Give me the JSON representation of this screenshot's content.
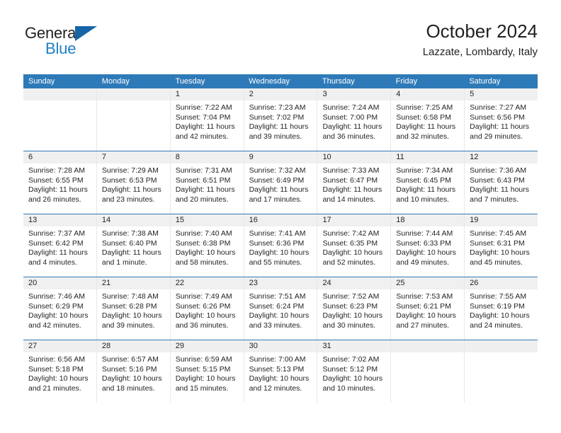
{
  "brand": {
    "name_top": "General",
    "name_bottom": "Blue",
    "logo_icon": "blue-triangle-icon",
    "colors": {
      "dark": "#231f20",
      "blue": "#1f7fc4",
      "triangle": "#1565a8"
    }
  },
  "header": {
    "title": "October 2024",
    "subtitle": "Lazzate, Lombardy, Italy"
  },
  "theme": {
    "header_blue": "#2e7ab8",
    "daynum_band": "#f0f0f0",
    "cell_border": "#e8e8e8",
    "text": "#231f20"
  },
  "weekdays": [
    "Sunday",
    "Monday",
    "Tuesday",
    "Wednesday",
    "Thursday",
    "Friday",
    "Saturday"
  ],
  "labels": {
    "sunrise_prefix": "Sunrise:",
    "sunset_prefix": "Sunset:",
    "daylight_prefix": "Daylight:"
  },
  "weeks": [
    [
      {
        "day": "",
        "empty": true
      },
      {
        "day": "",
        "empty": true
      },
      {
        "day": "1",
        "sunrise": "Sunrise: 7:22 AM",
        "sunset": "Sunset: 7:04 PM",
        "daylight_1": "Daylight: 11 hours",
        "daylight_2": "and 42 minutes."
      },
      {
        "day": "2",
        "sunrise": "Sunrise: 7:23 AM",
        "sunset": "Sunset: 7:02 PM",
        "daylight_1": "Daylight: 11 hours",
        "daylight_2": "and 39 minutes."
      },
      {
        "day": "3",
        "sunrise": "Sunrise: 7:24 AM",
        "sunset": "Sunset: 7:00 PM",
        "daylight_1": "Daylight: 11 hours",
        "daylight_2": "and 36 minutes."
      },
      {
        "day": "4",
        "sunrise": "Sunrise: 7:25 AM",
        "sunset": "Sunset: 6:58 PM",
        "daylight_1": "Daylight: 11 hours",
        "daylight_2": "and 32 minutes."
      },
      {
        "day": "5",
        "sunrise": "Sunrise: 7:27 AM",
        "sunset": "Sunset: 6:56 PM",
        "daylight_1": "Daylight: 11 hours",
        "daylight_2": "and 29 minutes."
      }
    ],
    [
      {
        "day": "6",
        "sunrise": "Sunrise: 7:28 AM",
        "sunset": "Sunset: 6:55 PM",
        "daylight_1": "Daylight: 11 hours",
        "daylight_2": "and 26 minutes."
      },
      {
        "day": "7",
        "sunrise": "Sunrise: 7:29 AM",
        "sunset": "Sunset: 6:53 PM",
        "daylight_1": "Daylight: 11 hours",
        "daylight_2": "and 23 minutes."
      },
      {
        "day": "8",
        "sunrise": "Sunrise: 7:31 AM",
        "sunset": "Sunset: 6:51 PM",
        "daylight_1": "Daylight: 11 hours",
        "daylight_2": "and 20 minutes."
      },
      {
        "day": "9",
        "sunrise": "Sunrise: 7:32 AM",
        "sunset": "Sunset: 6:49 PM",
        "daylight_1": "Daylight: 11 hours",
        "daylight_2": "and 17 minutes."
      },
      {
        "day": "10",
        "sunrise": "Sunrise: 7:33 AM",
        "sunset": "Sunset: 6:47 PM",
        "daylight_1": "Daylight: 11 hours",
        "daylight_2": "and 14 minutes."
      },
      {
        "day": "11",
        "sunrise": "Sunrise: 7:34 AM",
        "sunset": "Sunset: 6:45 PM",
        "daylight_1": "Daylight: 11 hours",
        "daylight_2": "and 10 minutes."
      },
      {
        "day": "12",
        "sunrise": "Sunrise: 7:36 AM",
        "sunset": "Sunset: 6:43 PM",
        "daylight_1": "Daylight: 11 hours",
        "daylight_2": "and 7 minutes."
      }
    ],
    [
      {
        "day": "13",
        "sunrise": "Sunrise: 7:37 AM",
        "sunset": "Sunset: 6:42 PM",
        "daylight_1": "Daylight: 11 hours",
        "daylight_2": "and 4 minutes."
      },
      {
        "day": "14",
        "sunrise": "Sunrise: 7:38 AM",
        "sunset": "Sunset: 6:40 PM",
        "daylight_1": "Daylight: 11 hours",
        "daylight_2": "and 1 minute."
      },
      {
        "day": "15",
        "sunrise": "Sunrise: 7:40 AM",
        "sunset": "Sunset: 6:38 PM",
        "daylight_1": "Daylight: 10 hours",
        "daylight_2": "and 58 minutes."
      },
      {
        "day": "16",
        "sunrise": "Sunrise: 7:41 AM",
        "sunset": "Sunset: 6:36 PM",
        "daylight_1": "Daylight: 10 hours",
        "daylight_2": "and 55 minutes."
      },
      {
        "day": "17",
        "sunrise": "Sunrise: 7:42 AM",
        "sunset": "Sunset: 6:35 PM",
        "daylight_1": "Daylight: 10 hours",
        "daylight_2": "and 52 minutes."
      },
      {
        "day": "18",
        "sunrise": "Sunrise: 7:44 AM",
        "sunset": "Sunset: 6:33 PM",
        "daylight_1": "Daylight: 10 hours",
        "daylight_2": "and 49 minutes."
      },
      {
        "day": "19",
        "sunrise": "Sunrise: 7:45 AM",
        "sunset": "Sunset: 6:31 PM",
        "daylight_1": "Daylight: 10 hours",
        "daylight_2": "and 45 minutes."
      }
    ],
    [
      {
        "day": "20",
        "sunrise": "Sunrise: 7:46 AM",
        "sunset": "Sunset: 6:29 PM",
        "daylight_1": "Daylight: 10 hours",
        "daylight_2": "and 42 minutes."
      },
      {
        "day": "21",
        "sunrise": "Sunrise: 7:48 AM",
        "sunset": "Sunset: 6:28 PM",
        "daylight_1": "Daylight: 10 hours",
        "daylight_2": "and 39 minutes."
      },
      {
        "day": "22",
        "sunrise": "Sunrise: 7:49 AM",
        "sunset": "Sunset: 6:26 PM",
        "daylight_1": "Daylight: 10 hours",
        "daylight_2": "and 36 minutes."
      },
      {
        "day": "23",
        "sunrise": "Sunrise: 7:51 AM",
        "sunset": "Sunset: 6:24 PM",
        "daylight_1": "Daylight: 10 hours",
        "daylight_2": "and 33 minutes."
      },
      {
        "day": "24",
        "sunrise": "Sunrise: 7:52 AM",
        "sunset": "Sunset: 6:23 PM",
        "daylight_1": "Daylight: 10 hours",
        "daylight_2": "and 30 minutes."
      },
      {
        "day": "25",
        "sunrise": "Sunrise: 7:53 AM",
        "sunset": "Sunset: 6:21 PM",
        "daylight_1": "Daylight: 10 hours",
        "daylight_2": "and 27 minutes."
      },
      {
        "day": "26",
        "sunrise": "Sunrise: 7:55 AM",
        "sunset": "Sunset: 6:19 PM",
        "daylight_1": "Daylight: 10 hours",
        "daylight_2": "and 24 minutes."
      }
    ],
    [
      {
        "day": "27",
        "sunrise": "Sunrise: 6:56 AM",
        "sunset": "Sunset: 5:18 PM",
        "daylight_1": "Daylight: 10 hours",
        "daylight_2": "and 21 minutes."
      },
      {
        "day": "28",
        "sunrise": "Sunrise: 6:57 AM",
        "sunset": "Sunset: 5:16 PM",
        "daylight_1": "Daylight: 10 hours",
        "daylight_2": "and 18 minutes."
      },
      {
        "day": "29",
        "sunrise": "Sunrise: 6:59 AM",
        "sunset": "Sunset: 5:15 PM",
        "daylight_1": "Daylight: 10 hours",
        "daylight_2": "and 15 minutes."
      },
      {
        "day": "30",
        "sunrise": "Sunrise: 7:00 AM",
        "sunset": "Sunset: 5:13 PM",
        "daylight_1": "Daylight: 10 hours",
        "daylight_2": "and 12 minutes."
      },
      {
        "day": "31",
        "sunrise": "Sunrise: 7:02 AM",
        "sunset": "Sunset: 5:12 PM",
        "daylight_1": "Daylight: 10 hours",
        "daylight_2": "and 10 minutes."
      },
      {
        "day": "",
        "empty": true
      },
      {
        "day": "",
        "empty": true
      }
    ]
  ]
}
